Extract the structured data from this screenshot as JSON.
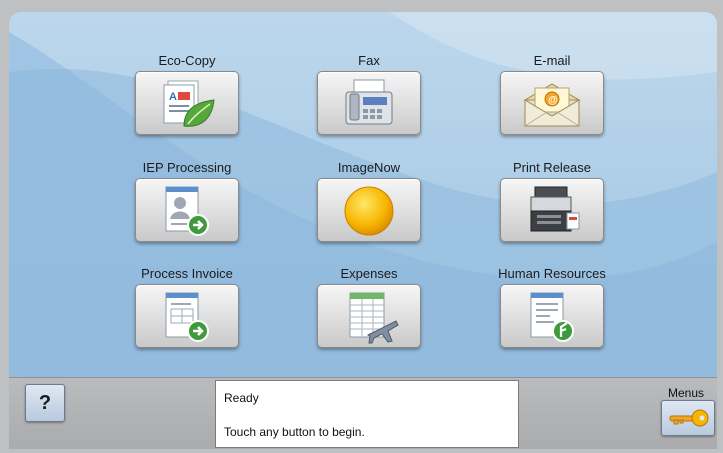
{
  "tiles": [
    {
      "label": "Eco-Copy",
      "icon": "eco-copy-icon"
    },
    {
      "label": "Fax",
      "icon": "fax-icon"
    },
    {
      "label": "E-mail",
      "icon": "email-icon"
    },
    {
      "label": "IEP Processing",
      "icon": "iep-processing-icon"
    },
    {
      "label": "ImageNow",
      "icon": "imagenow-icon"
    },
    {
      "label": "Print Release",
      "icon": "printer-icon"
    },
    {
      "label": "Process Invoice",
      "icon": "process-invoice-icon"
    },
    {
      "label": "Expenses",
      "icon": "expenses-icon"
    },
    {
      "label": "Human Resources",
      "icon": "human-resources-icon"
    }
  ],
  "status": {
    "help_label": "?",
    "line1": "Ready",
    "line2": "Touch any button to begin.",
    "menus_label": "Menus",
    "menus_icon": "key-icon"
  },
  "colors": {
    "background": "#a9cbe6",
    "imagenow_accent": "#f7b500",
    "arrow_green": "#3f9a3c"
  }
}
